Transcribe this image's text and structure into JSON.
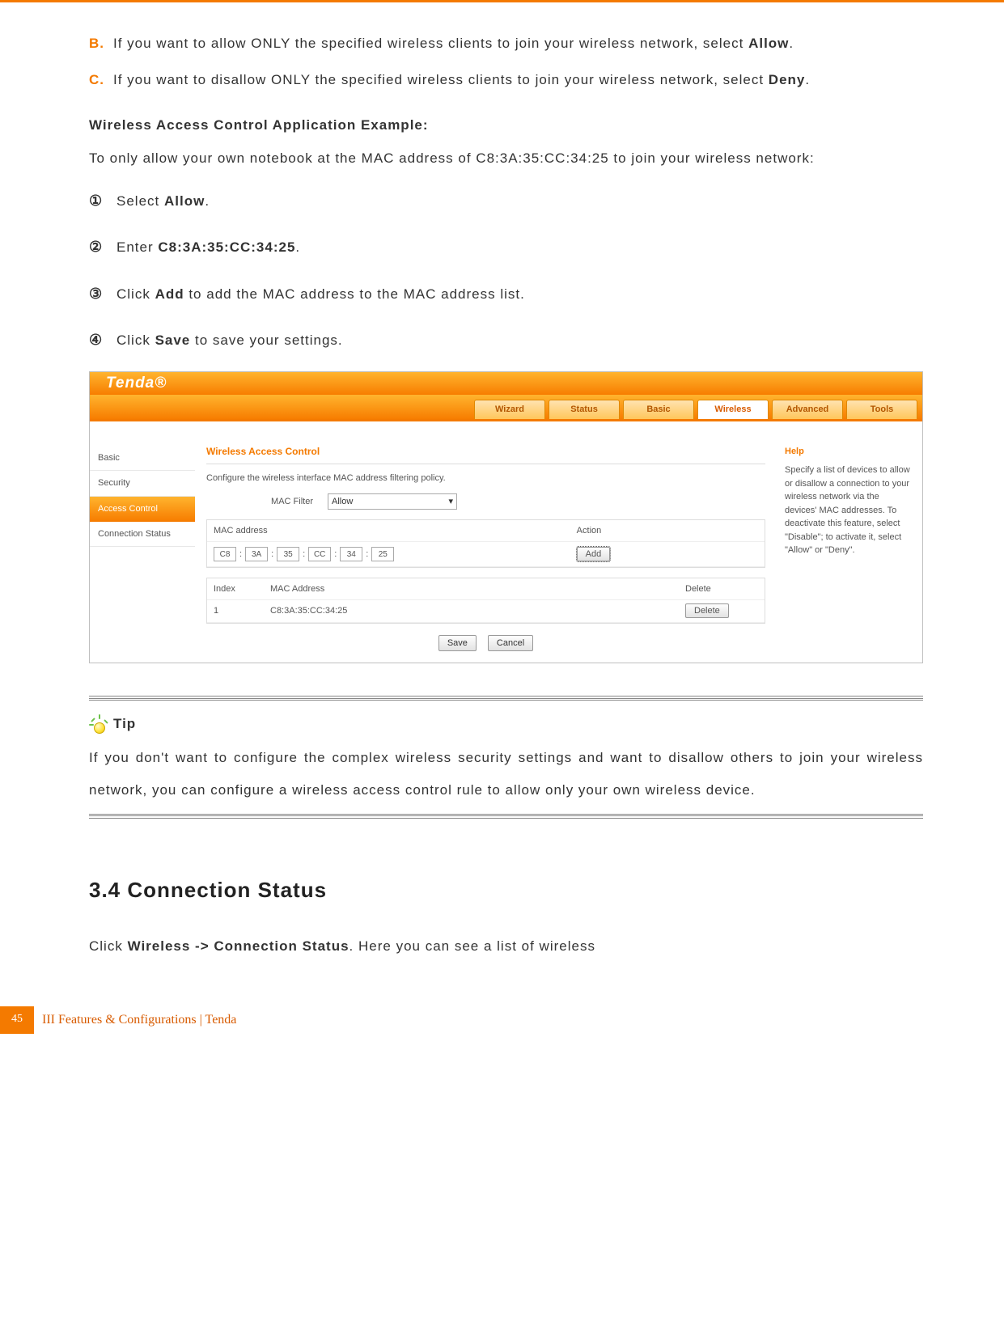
{
  "itemB": {
    "marker": "B.",
    "text_pre": "If you want to allow ONLY the specified wireless clients to join your wireless network, select ",
    "bold": "Allow",
    "post": "."
  },
  "itemC": {
    "marker": "C.",
    "text_pre": "If you want to disallow ONLY the specified wireless clients to join your wireless network, select ",
    "bold": "Deny",
    "post": "."
  },
  "example_heading": "Wireless Access Control Application Example:",
  "example_intro": "To only allow your own notebook at the MAC address of C8:3A:35:CC:34:25 to join your wireless network:",
  "steps": {
    "s1": {
      "marker": "①",
      "pre": "Select ",
      "bold": "Allow",
      "post": "."
    },
    "s2": {
      "marker": "②",
      "pre": "Enter ",
      "bold": "C8:3A:35:CC:34:25",
      "post": "."
    },
    "s3": {
      "marker": "③",
      "pre": "Click ",
      "bold": "Add",
      "post": " to add the MAC address to the MAC address list."
    },
    "s4": {
      "marker": "④",
      "pre": "Click ",
      "bold": "Save",
      "post": " to save your settings."
    }
  },
  "ss": {
    "logo": "Tenda®",
    "tabs": {
      "wizard": "Wizard",
      "status": "Status",
      "basic": "Basic",
      "wireless": "Wireless",
      "advanced": "Advanced",
      "tools": "Tools"
    },
    "sidebar": {
      "basic": "Basic",
      "security": "Security",
      "access": "Access Control",
      "conn": "Connection Status"
    },
    "panel_title": "Wireless Access Control",
    "panel_desc": "Configure the wireless interface MAC address filtering policy.",
    "mac_filter_label": "MAC Filter",
    "mac_filter_value": "Allow",
    "mac_header": "MAC address",
    "action_header": "Action",
    "mac": {
      "b1": "C8",
      "b2": "3A",
      "b3": "35",
      "b4": "CC",
      "b5": "34",
      "b6": "25"
    },
    "add_btn": "Add",
    "index_h": "Index",
    "macaddr_h": "MAC Address",
    "delete_h": "Delete",
    "row1_idx": "1",
    "row1_mac": "C8:3A:35:CC:34:25",
    "delete_btn": "Delete",
    "save_btn": "Save",
    "cancel_btn": "Cancel",
    "help_title": "Help",
    "help_text": "Specify a list of devices to allow or disallow a connection to your wireless network via the devices' MAC addresses. To deactivate this feature, select \"Disable\"; to activate it, select \"Allow\" or \"Deny\"."
  },
  "tip_label": "Tip",
  "tip_text": "If you don't want to configure the complex wireless security settings and want to disallow others to join your wireless network, you can configure a wireless access control rule to allow only your own wireless device.",
  "section_heading": "3.4 Connection Status",
  "section_para_pre": "Click ",
  "section_para_bold": "Wireless -> Connection Status",
  "section_para_post": ". Here you can see a list of wireless",
  "footer": {
    "num": "45",
    "text": "III Features & Configurations | Tenda"
  }
}
